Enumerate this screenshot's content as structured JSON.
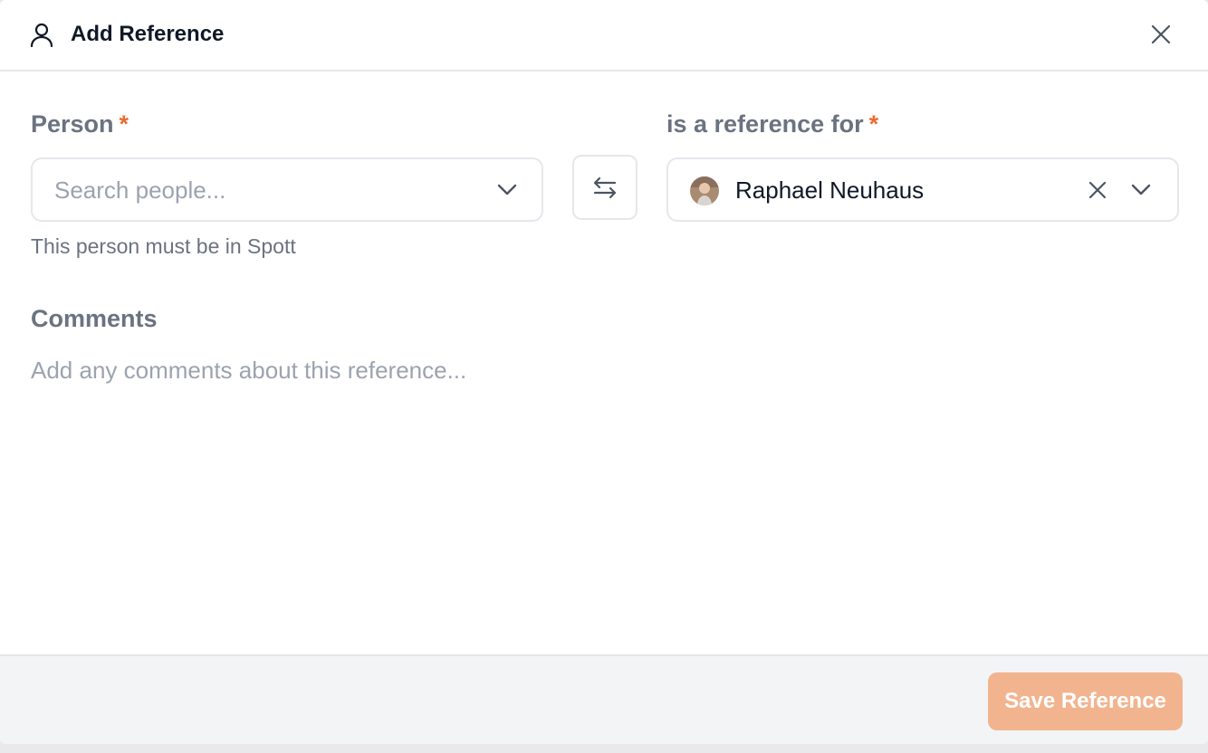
{
  "header": {
    "title": "Add Reference",
    "icon": "user-icon"
  },
  "person_field": {
    "label": "Person",
    "required_mark": "*",
    "placeholder": "Search people...",
    "helper": "This person must be in Spott"
  },
  "reference_field": {
    "label": "is a reference for",
    "required_mark": "*",
    "selected_value": "Raphael Neuhaus"
  },
  "comments": {
    "label": "Comments",
    "placeholder": "Add any comments about this reference..."
  },
  "footer": {
    "save_label": "Save Reference"
  },
  "colors": {
    "accent": "#ea6c2f",
    "save_button_disabled": "#f2b48f",
    "label": "#6b7280",
    "border": "#e5e7eb"
  }
}
